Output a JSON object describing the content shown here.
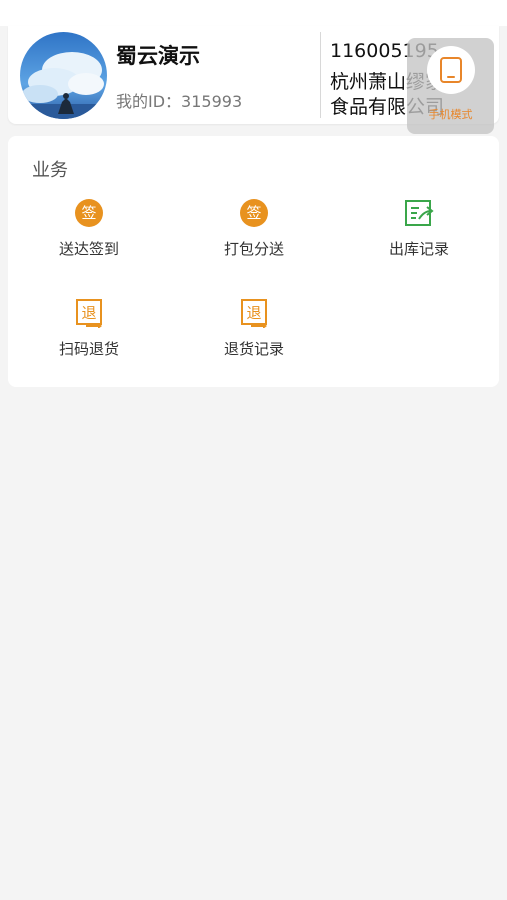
{
  "profile": {
    "name": "蜀云演示",
    "id_text": "我的ID：315993",
    "company_code": "116005195",
    "company_name": "杭州萧山缪家食品有限公司"
  },
  "mode_button": {
    "label": "手机模式",
    "icon": "tablet-icon"
  },
  "business": {
    "title": "业务",
    "items": [
      {
        "label": "送达签到",
        "icon": "sign-icon"
      },
      {
        "label": "打包分送",
        "icon": "sign-icon"
      },
      {
        "label": "出库记录",
        "icon": "outbound-record-icon"
      },
      {
        "label": "扫码退货",
        "icon": "return-icon"
      },
      {
        "label": "退货记录",
        "icon": "return-icon"
      }
    ]
  },
  "colors": {
    "accent_orange": "#e8921f",
    "accent_green": "#3aa64a",
    "background": "#f4f4f4"
  }
}
